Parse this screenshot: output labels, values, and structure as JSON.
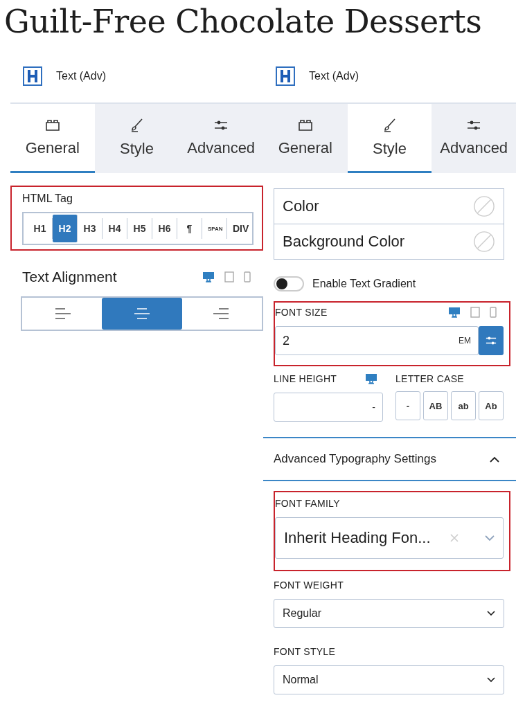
{
  "title": "Guilt-Free Chocolate Desserts",
  "left_panel": {
    "header": "Text (Adv)",
    "tabs": [
      {
        "kind": "general",
        "label": "General",
        "selected": true
      },
      {
        "kind": "style",
        "label": "Style",
        "selected": false
      },
      {
        "kind": "advanced",
        "label": "Advanced",
        "selected": false
      }
    ],
    "html_tag": {
      "label": "HTML Tag",
      "highlighted": true,
      "options": [
        {
          "label": "H1",
          "selected": false
        },
        {
          "label": "H2",
          "selected": true
        },
        {
          "label": "H3",
          "selected": false
        },
        {
          "label": "H4",
          "selected": false
        },
        {
          "label": "H5",
          "selected": false
        },
        {
          "label": "H6",
          "selected": false
        },
        {
          "label": "¶",
          "selected": false
        },
        {
          "label": "SPAN",
          "kind": "small",
          "selected": false
        },
        {
          "label": "DIV",
          "selected": false
        }
      ]
    },
    "text_alignment": {
      "label": "Text Alignment",
      "devices": [
        {
          "kind": "desktop",
          "selected": true
        },
        {
          "kind": "tablet",
          "selected": false
        },
        {
          "kind": "mobile",
          "selected": false
        }
      ],
      "options": [
        {
          "kind": "left",
          "selected": false
        },
        {
          "kind": "center",
          "selected": true
        },
        {
          "kind": "right",
          "selected": false
        }
      ]
    }
  },
  "right_panel": {
    "header": "Text (Adv)",
    "tabs": [
      {
        "kind": "general",
        "label": "General",
        "selected": false
      },
      {
        "kind": "style",
        "label": "Style",
        "selected": true
      },
      {
        "kind": "advanced",
        "label": "Advanced",
        "selected": false
      }
    ],
    "colors": [
      {
        "label": "Color"
      },
      {
        "label": "Background Color"
      }
    ],
    "gradient_toggle": {
      "label": "Enable Text Gradient",
      "on": false
    },
    "font_size": {
      "label": "FONT SIZE",
      "highlighted": true,
      "value": "2",
      "unit": "EM",
      "devices": [
        {
          "kind": "desktop",
          "selected": true
        },
        {
          "kind": "tablet",
          "selected": false
        },
        {
          "kind": "mobile",
          "selected": false
        }
      ]
    },
    "line_height": {
      "label": "LINE HEIGHT",
      "unit": "-",
      "devices": [
        {
          "kind": "desktop",
          "selected": true
        }
      ]
    },
    "letter_case": {
      "label": "LETTER CASE",
      "options": [
        {
          "label": "-",
          "selected": false
        },
        {
          "label": "AB",
          "selected": false
        },
        {
          "label": "ab",
          "selected": false
        },
        {
          "label": "Ab",
          "selected": false
        }
      ]
    },
    "advanced_typography": {
      "label": "Advanced Typography Settings",
      "expanded": true
    },
    "font_family": {
      "label": "FONT FAMILY",
      "highlighted": true,
      "value": "Inherit Heading Fon..."
    },
    "font_weight": {
      "label": "FONT WEIGHT",
      "value": "Regular"
    },
    "font_style": {
      "label": "FONT STYLE",
      "value": "Normal"
    }
  }
}
